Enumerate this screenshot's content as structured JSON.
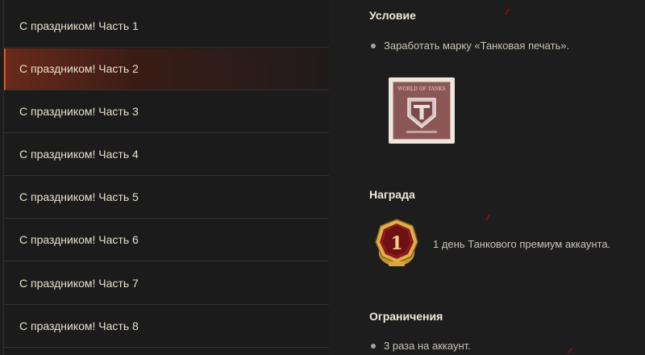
{
  "missions": [
    {
      "label": "С праздником! Часть 1",
      "active": false
    },
    {
      "label": "С праздником! Часть 2",
      "active": true
    },
    {
      "label": "С праздником! Часть 3",
      "active": false
    },
    {
      "label": "С праздником! Часть 4",
      "active": false
    },
    {
      "label": "С праздником! Часть 5",
      "active": false
    },
    {
      "label": "С праздником! Часть 6",
      "active": false
    },
    {
      "label": "С праздником! Часть 7",
      "active": false
    },
    {
      "label": "С праздником! Часть 8",
      "active": false
    }
  ],
  "details": {
    "condition_title": "Условие",
    "condition_text": "Заработать марку «Танковая печать».",
    "stamp_text": "WORLD OF TANKS",
    "reward_title": "Награда",
    "reward_badge_number": "1",
    "reward_text": "1 день Танкового премиум аккаунта.",
    "limits_title": "Ограничения",
    "limits_text": "3 раза на аккаунт."
  },
  "colors": {
    "background": "#1d1d1e",
    "active_accent": "#c95a2e",
    "badge_red": "#8e1a1d",
    "badge_gold": "#d9a640"
  }
}
